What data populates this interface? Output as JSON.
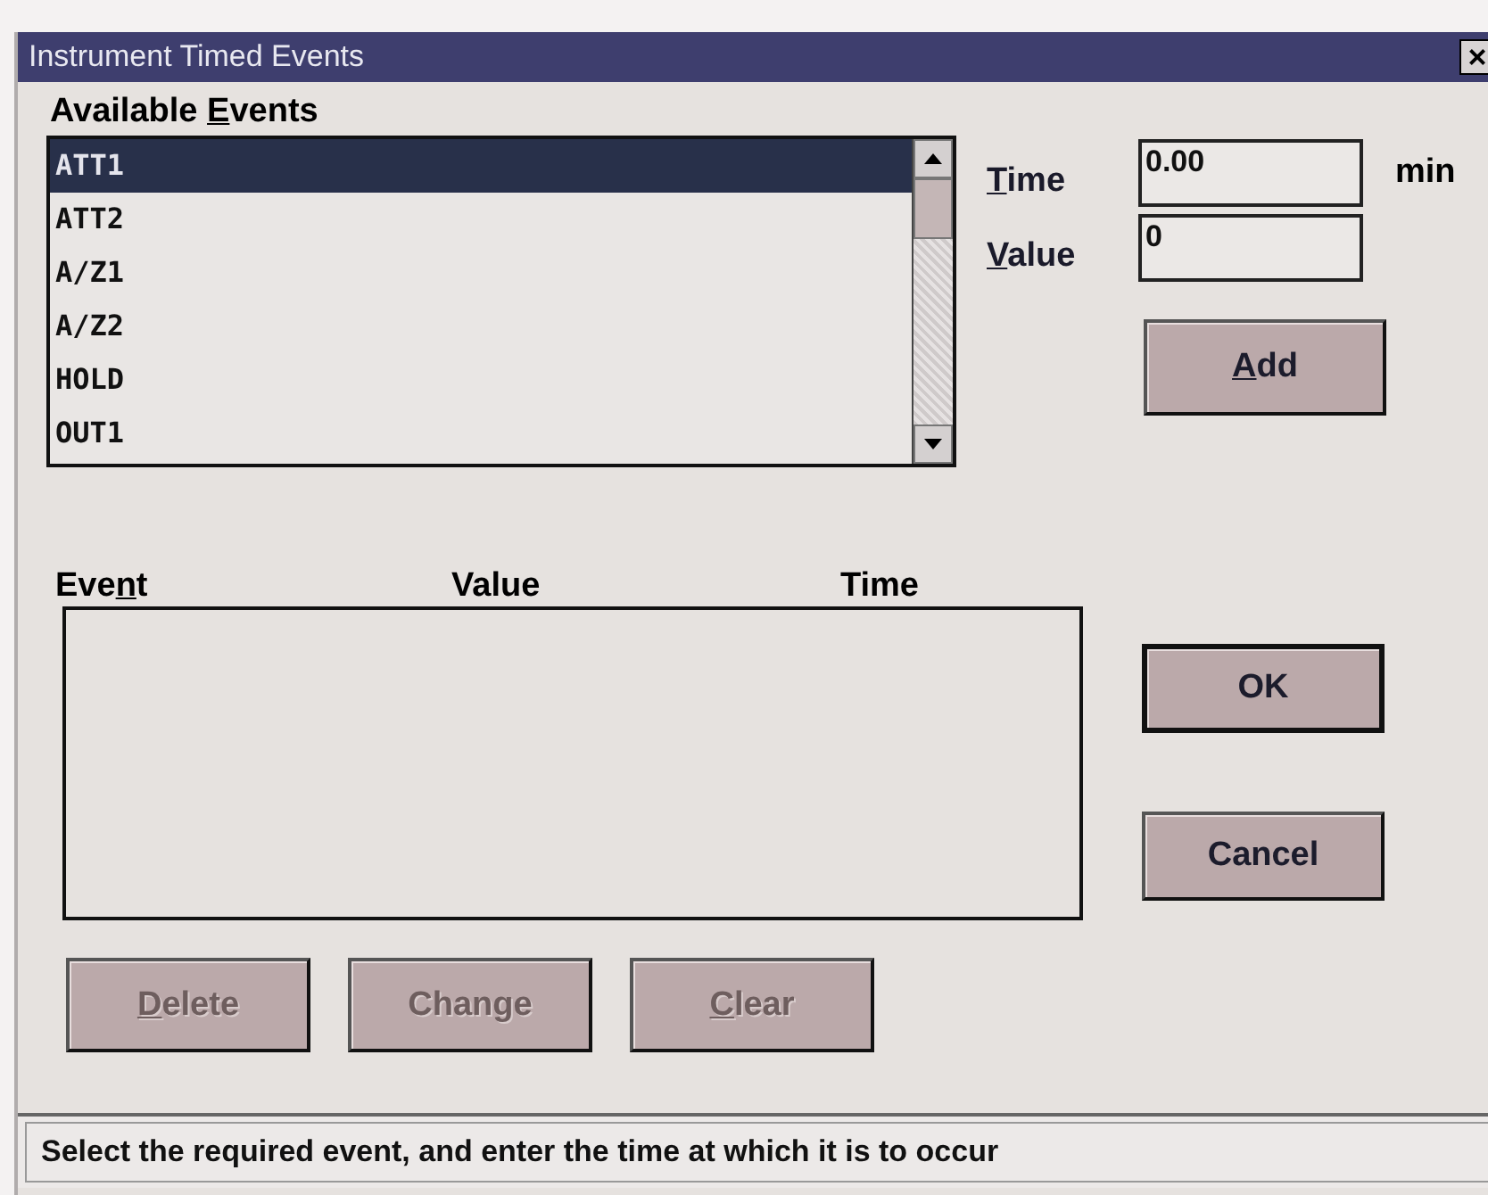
{
  "window": {
    "title": "Instrument Timed Events",
    "close": "×"
  },
  "available_events": {
    "label": {
      "pre": "Available ",
      "key": "E",
      "post": "vents"
    },
    "items": [
      {
        "text": "ATT1",
        "selected": true
      },
      {
        "text": "ATT2",
        "selected": false
      },
      {
        "text": "A/Z1",
        "selected": false
      },
      {
        "text": "A/Z2",
        "selected": false
      },
      {
        "text": "HOLD",
        "selected": false
      },
      {
        "text": "OUT1",
        "selected": false
      }
    ]
  },
  "time": {
    "label": {
      "key": "T",
      "post": "ime"
    },
    "value": "0.00",
    "unit": "min"
  },
  "value": {
    "label": {
      "key": "V",
      "post": "alue"
    },
    "value": "0"
  },
  "add_button": {
    "label": {
      "key": "A",
      "post": "dd"
    },
    "disabled": false
  },
  "event_table": {
    "columns": [
      {
        "pre": "Eve",
        "key": "n",
        "post": "t"
      },
      {
        "post": "Value"
      },
      {
        "post": "Time"
      }
    ]
  },
  "dialog_buttons": [
    {
      "label": {
        "post": "OK"
      },
      "default": true,
      "disabled": false
    },
    {
      "label": {
        "post": "Cancel"
      },
      "default": false,
      "disabled": false
    }
  ],
  "edit_buttons": [
    {
      "label": {
        "key": "D",
        "post": "elete"
      },
      "disabled": true
    },
    {
      "label": {
        "post": "Change"
      },
      "disabled": true
    },
    {
      "label": {
        "key": "C",
        "post": "lear"
      },
      "disabled": true
    }
  ],
  "status_bar": "Select the required event, and enter the time at which it is to occur"
}
